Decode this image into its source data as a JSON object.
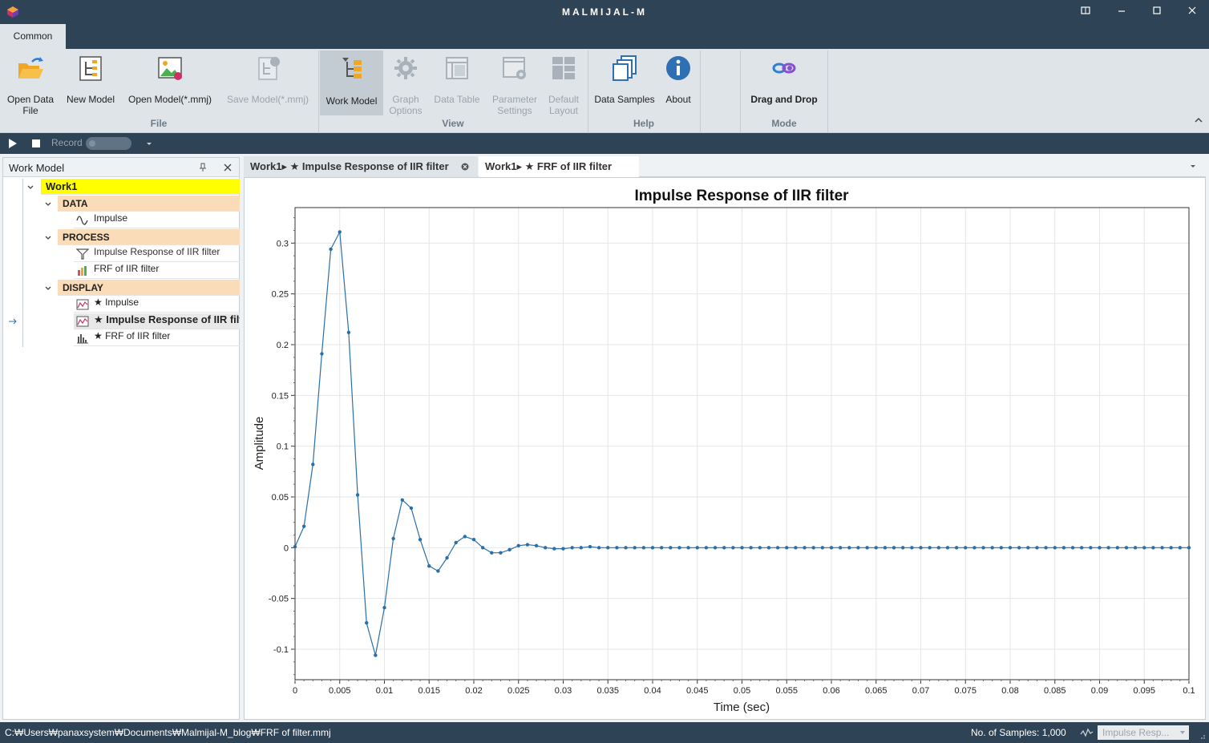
{
  "window": {
    "title": "MALMIJAL-M",
    "controls": [
      "restore-icon",
      "minimize-icon",
      "maximize-icon",
      "close-icon"
    ]
  },
  "ribbon": {
    "tab": "Common",
    "file_group": "File",
    "view_group": "View",
    "help_group": "Help",
    "mode_group": "Mode",
    "buttons": {
      "open_data_file_1": "Open Data",
      "open_data_file_2": "File",
      "new_model": "New Model",
      "open_model": "Open Model(*.mmj)",
      "save_model": "Save Model(*.mmj)",
      "work_model": "Work Model",
      "graph_options_1": "Graph",
      "graph_options_2": "Options",
      "data_table": "Data Table",
      "parameter_settings_1": "Parameter",
      "parameter_settings_2": "Settings",
      "default_layout_1": "Default",
      "default_layout_2": "Layout",
      "data_samples": "Data Samples",
      "about": "About",
      "drag_and_drop": "Drag and Drop"
    }
  },
  "recordbar": {
    "record_label": "Record"
  },
  "work_model": {
    "title": "Work Model",
    "root": "Work1",
    "sections": {
      "data": "DATA",
      "process": "PROCESS",
      "display": "DISPLAY"
    },
    "items": {
      "impulse": "Impulse",
      "proc_impulse_response": "Impulse Response of IIR filter",
      "proc_frf": "FRF of IIR filter",
      "disp_impulse": "★ Impulse",
      "disp_impulse_response": "★ Impulse Response of IIR filter",
      "disp_frf": "★ FRF of IIR filter"
    }
  },
  "doc_tabs": [
    {
      "label": "Work1▸ ★ Impulse Response of IIR filter",
      "active": true
    },
    {
      "label": "Work1▸ ★ FRF of IIR filter",
      "active": false
    }
  ],
  "statusbar": {
    "path": "C:₩Users₩panaxsystem₩Documents₩Malmijal-M_blog₩FRF of filter.mmj",
    "samples": "No. of Samples: 1,000",
    "selector": "Impulse Resp..."
  },
  "colors": {
    "titlebar": "#2f4356",
    "ribbon": "#dfe4e8",
    "root_highlight": "#ffff00",
    "section_bg": "#fbdcb9",
    "series": "#2a6fa8"
  },
  "chart_data": {
    "type": "line",
    "title": "Impulse Response of IIR filter",
    "xlabel": "Time (sec)",
    "ylabel": "Amplitude",
    "xlim": [
      0,
      0.1
    ],
    "ylim": [
      -0.13,
      0.335
    ],
    "xticks": [
      "0",
      "0.005",
      "0.01",
      "0.015",
      "0.02",
      "0.025",
      "0.03",
      "0.035",
      "0.04",
      "0.045",
      "0.05",
      "0.055",
      "0.06",
      "0.065",
      "0.07",
      "0.075",
      "0.08",
      "0.085",
      "0.09",
      "0.095",
      "0.1"
    ],
    "yticks": [
      "-0.1",
      "-0.05",
      "0",
      "0.05",
      "0.1",
      "0.15",
      "0.2",
      "0.25",
      "0.3"
    ],
    "grid": true,
    "series": [
      {
        "x": [
          0,
          0.001,
          0.002,
          0.003,
          0.004,
          0.005,
          0.006,
          0.007,
          0.008,
          0.009,
          0.01,
          0.011,
          0.012,
          0.013,
          0.014,
          0.015,
          0.016,
          0.017,
          0.018,
          0.019,
          0.02,
          0.021,
          0.022,
          0.023,
          0.024,
          0.025,
          0.026,
          0.027,
          0.028,
          0.029,
          0.03,
          0.031,
          0.032,
          0.033,
          0.034,
          0.035,
          0.036,
          0.037,
          0.038,
          0.039,
          0.04,
          0.041,
          0.042,
          0.043,
          0.044,
          0.045,
          0.046,
          0.047,
          0.048,
          0.049,
          0.05,
          0.051,
          0.052,
          0.053,
          0.054,
          0.055,
          0.056,
          0.057,
          0.058,
          0.059,
          0.06,
          0.061,
          0.062,
          0.063,
          0.064,
          0.065,
          0.066,
          0.067,
          0.068,
          0.069,
          0.07,
          0.071,
          0.072,
          0.073,
          0.074,
          0.075,
          0.076,
          0.077,
          0.078,
          0.079,
          0.08,
          0.081,
          0.082,
          0.083,
          0.084,
          0.085,
          0.086,
          0.087,
          0.088,
          0.089,
          0.09,
          0.091,
          0.092,
          0.093,
          0.094,
          0.095,
          0.096,
          0.097,
          0.098,
          0.099,
          0.1
        ],
        "y": [
          0.001,
          0.021,
          0.082,
          0.191,
          0.294,
          0.311,
          0.212,
          0.052,
          -0.074,
          -0.106,
          -0.059,
          0.009,
          0.047,
          0.039,
          0.008,
          -0.018,
          -0.023,
          -0.01,
          0.005,
          0.011,
          0.008,
          0.0,
          -0.005,
          -0.005,
          -0.002,
          0.002,
          0.003,
          0.002,
          0.0,
          -0.001,
          -0.001,
          0.0,
          0.0,
          0.001,
          0.0,
          0.0,
          0,
          0,
          0,
          0,
          0,
          0,
          0,
          0,
          0,
          0,
          0,
          0,
          0,
          0,
          0,
          0,
          0,
          0,
          0,
          0,
          0,
          0,
          0,
          0,
          0,
          0,
          0,
          0,
          0,
          0,
          0,
          0,
          0,
          0,
          0,
          0,
          0,
          0,
          0,
          0,
          0,
          0,
          0,
          0,
          0,
          0,
          0,
          0,
          0,
          0,
          0,
          0,
          0,
          0,
          0,
          0,
          0,
          0,
          0,
          0,
          0,
          0,
          0,
          0,
          0
        ]
      }
    ]
  }
}
